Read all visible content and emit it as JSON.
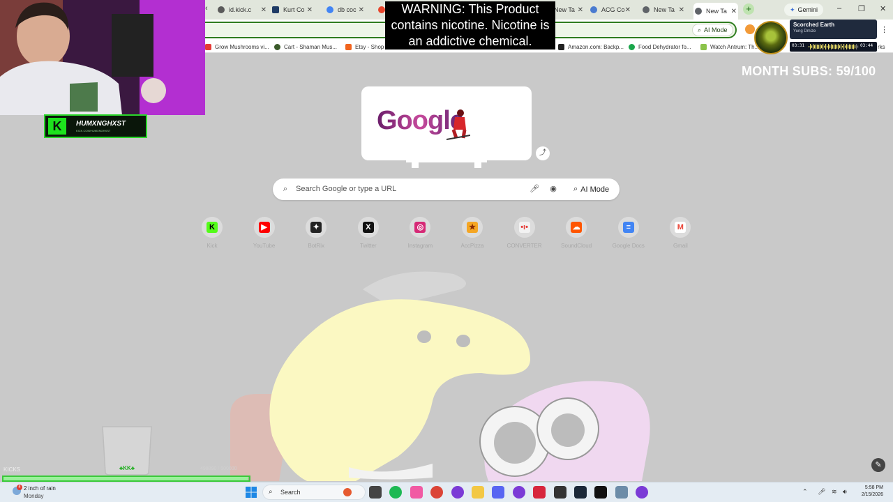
{
  "browser": {
    "tabs": [
      {
        "label": "id.kick.c",
        "favicon_color": "#5a5a5a",
        "active": false
      },
      {
        "label": "Kurt Co",
        "favicon_color": "#1f3b66",
        "active": false
      },
      {
        "label": "db coc",
        "favicon_color": "#4285f4",
        "active": false
      },
      {
        "label": "",
        "favicon_color": "#e8452c",
        "active": false
      },
      {
        "label": "New Ta",
        "favicon_color": "#5f6368",
        "active": false
      },
      {
        "label": "ACG Co",
        "favicon_color": "#4a7bd0",
        "active": false
      },
      {
        "label": "New Ta",
        "favicon_color": "#5f6368",
        "active": false
      },
      {
        "label": "New Ta",
        "favicon_color": "#5f6368",
        "active": true
      }
    ],
    "new_tab_symbol": "+",
    "gemini_label": "Gemini",
    "omnibox_ai_mode": "AI Mode",
    "bookmarks": [
      {
        "label": "Grow Mushrooms vi...",
        "color": "#e53935"
      },
      {
        "label": "Cart - Shaman Mus...",
        "color": "#3a5a2a"
      },
      {
        "label": "Etsy - Shop",
        "color": "#f1641e"
      },
      {
        "label": "Amazon.com: Backp...",
        "color": "#222222"
      },
      {
        "label": "Food Dehydrator fo...",
        "color": "#1aa64b"
      },
      {
        "label": "Watch Antrum: Th...",
        "color": "#8bc34a"
      },
      {
        "label": "rks",
        "color": "#cccccc"
      }
    ]
  },
  "ntp": {
    "doodle_text": "Google",
    "search_placeholder": "Search Google or type a URL",
    "ai_mode_label": "AI Mode",
    "shortcuts": [
      {
        "label": "Kick",
        "glyph": "K",
        "color": "#53fc18",
        "glyph_color": "#000000"
      },
      {
        "label": "YouTube",
        "glyph": "▶",
        "color": "#ff0000",
        "glyph_color": "#ffffff"
      },
      {
        "label": "BotRix",
        "glyph": "✦",
        "color": "#222222",
        "glyph_color": "#ffffff"
      },
      {
        "label": "Twitter",
        "glyph": "X",
        "color": "#111111",
        "glyph_color": "#ffffff"
      },
      {
        "label": "Instagram",
        "glyph": "◎",
        "color": "#d62976",
        "glyph_color": "#ffffff"
      },
      {
        "label": "AccPizza",
        "glyph": "★",
        "color": "#f5a623",
        "glyph_color": "#8a2b00"
      },
      {
        "label": "CONVERTER",
        "glyph": "•ı•",
        "color": "#f2f2f2",
        "glyph_color": "#e53935"
      },
      {
        "label": "SoundCloud",
        "glyph": "☁",
        "color": "#ff5500",
        "glyph_color": "#ffffff"
      },
      {
        "label": "Google Docs",
        "glyph": "≡",
        "color": "#4285f4",
        "glyph_color": "#ffffff"
      },
      {
        "label": "Gmail",
        "glyph": "M",
        "color": "#ffffff",
        "glyph_color": "#ea4335"
      }
    ]
  },
  "overlay": {
    "warning_text": "WARNING: This Product contains nicotine. Nicotine is an addictive chemical.",
    "channel_name": "HUMXNGHXST",
    "channel_url": "KICK.COM/HUMXNGHXST",
    "subs_text": "MONTH SUBS: 59/100",
    "music": {
      "title": "Scorched Earth",
      "artist": "Yung Dmize",
      "elapsed": "03:31",
      "total": "03:44",
      "progress": 0.94
    },
    "kicks": {
      "label": "KICKS",
      "count": "498890 / 500000",
      "progress": 0.998
    },
    "jar_label": "♣KK♣"
  },
  "taskbar": {
    "weather_temp": "2 inch of rain",
    "weather_day": "Monday",
    "weather_badge": "4",
    "search_label": "Search",
    "time": "5:58 PM",
    "date": "2/15/2026",
    "apps": [
      {
        "name": "file-explorer-app",
        "color": "#444444"
      },
      {
        "name": "spotify-app",
        "color": "#1db954"
      },
      {
        "name": "itunes-app",
        "color": "#f15aa3"
      },
      {
        "name": "chrome-app",
        "color": "#db4437"
      },
      {
        "name": "obs-app",
        "color": "#7b3bd6"
      },
      {
        "name": "folder-app",
        "color": "#f3c844"
      },
      {
        "name": "discord-app",
        "color": "#5865f2"
      },
      {
        "name": "obs-app-2",
        "color": "#7b3bd6"
      },
      {
        "name": "screenshot-app",
        "color": "#d7263d"
      },
      {
        "name": "steelseries-app",
        "color": "#333333"
      },
      {
        "name": "steam-app",
        "color": "#1b2838"
      },
      {
        "name": "capcut-app",
        "color": "#111111"
      },
      {
        "name": "snipping-app",
        "color": "#6c8ca8"
      },
      {
        "name": "browser-app",
        "color": "#7b3bd6"
      }
    ]
  }
}
